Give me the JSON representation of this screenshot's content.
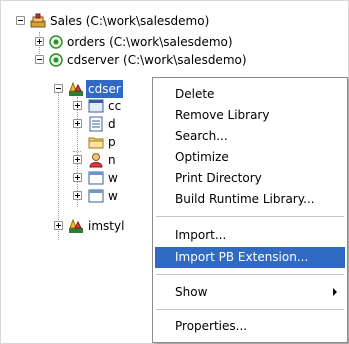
{
  "tree": {
    "root_label": "Sales (C:\\work\\salesdemo)",
    "orders_label": "orders (C:\\work\\salesdemo)",
    "cdserver_label": "cdserver (C:\\work\\salesdemo)",
    "cdserver_lib_label": "cdser",
    "child_c_label": "cc",
    "child_d_label": "d",
    "child_p_label": "p",
    "child_n_label": "n",
    "child_w1_label": "w",
    "child_w2_label": "w",
    "imstyl_label": "imstyl"
  },
  "context_menu": {
    "delete": "Delete",
    "remove_library": "Remove Library",
    "search": "Search...",
    "optimize": "Optimize",
    "print_directory": "Print Directory",
    "build_runtime_library": "Build Runtime Library...",
    "import": "Import...",
    "import_pb_extension": "Import PB Extension...",
    "show": "Show",
    "properties": "Properties..."
  },
  "colors": {
    "selection": "#316ac5",
    "menu_border": "#8c8c8c"
  }
}
